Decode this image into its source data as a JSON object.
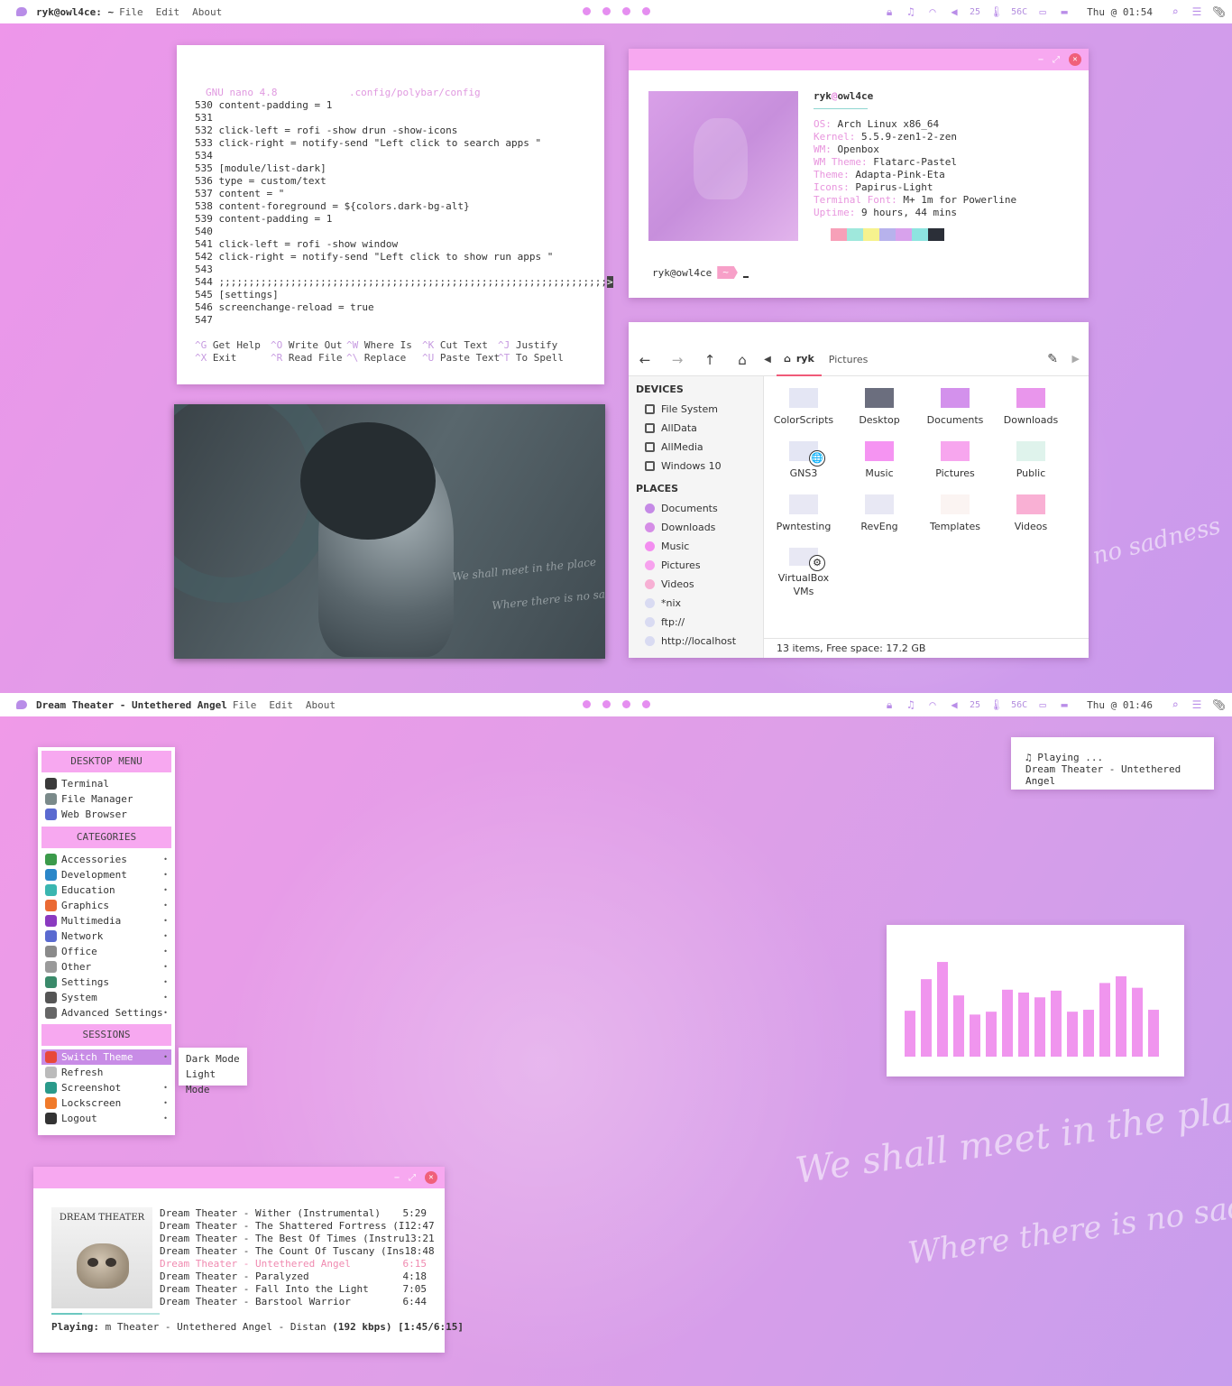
{
  "top_bar": {
    "window_title": "ryk@owl4ce: ~",
    "menu": [
      "File",
      "Edit",
      "About"
    ],
    "volume": "25",
    "temp": "56C",
    "clock": "Thu @ 01:54"
  },
  "bottom_bar": {
    "window_title": "Dream Theater - Untethered Angel",
    "menu": [
      "File",
      "Edit",
      "About"
    ],
    "volume": "25",
    "temp": "56C",
    "clock": "Thu @ 01:46"
  },
  "wallpaper_text": {
    "line1": "We shall meet in the place",
    "line2": "Where there is no sadness",
    "top_fragment": "no sadness"
  },
  "nano": {
    "header": "GNU nano 4.8            .config/polybar/config",
    "lines": [
      "530 content-padding = 1",
      "531",
      "532 click-left = rofi -show drun -show-icons",
      "533 click-right = notify-send \"Left click to search apps \"",
      "534",
      "535 [module/list-dark]",
      "536 type = custom/text",
      "537 content = \"",
      "538 content-foreground = ${colors.dark-bg-alt}",
      "539 content-padding = 1",
      "540",
      "541 click-left = rofi -show window",
      "542 click-right = notify-send \"Left click to show run apps \"",
      "543",
      "544 ;;;;;;;;;;;;;;;;;;;;;;;;;;;;;;;;;;;;;;;;;;;;;;;;;;;;;;;;;;;;;;;;;",
      "545 [settings]",
      "546 screenchange-reload = true",
      "547"
    ],
    "help": [
      {
        "key": "^G",
        "label": "Get Help"
      },
      {
        "key": "^O",
        "label": "Write Out"
      },
      {
        "key": "^W",
        "label": "Where Is"
      },
      {
        "key": "^K",
        "label": "Cut Text"
      },
      {
        "key": "^J",
        "label": "Justify"
      },
      {
        "key": "^X",
        "label": "Exit"
      },
      {
        "key": "^R",
        "label": "Read File"
      },
      {
        "key": "^\\",
        "label": "Replace"
      },
      {
        "key": "^U",
        "label": "Paste Text"
      },
      {
        "key": "^T",
        "label": "To Spell"
      }
    ]
  },
  "neofetch": {
    "user": "ryk",
    "host": "owl4ce",
    "rows": [
      {
        "k": "OS:",
        "v": "Arch Linux x86_64"
      },
      {
        "k": "Kernel:",
        "v": "5.5.9-zen1-2-zen"
      },
      {
        "k": "WM:",
        "v": "Openbox"
      },
      {
        "k": "WM Theme:",
        "v": "Flatarc-Pastel"
      },
      {
        "k": "Theme:",
        "v": "Adapta-Pink-Eta"
      },
      {
        "k": "Icons:",
        "v": "Papirus-Light"
      },
      {
        "k": "Terminal Font:",
        "v": "M+ 1m for Powerline"
      },
      {
        "k": "Uptime:",
        "v": "9 hours, 44 mins"
      }
    ],
    "swatches": [
      "#f7a0b8",
      "#9fe8dc",
      "#f6f28e",
      "#b7b2ec",
      "#d8a2ec",
      "#8ee4e0",
      "#2b2f38"
    ],
    "prompt": "ryk@owl4ce",
    "prompt_arrow": "~"
  },
  "image_text": {
    "line1": "We shall meet in the place",
    "line2": "Where there is no sadness"
  },
  "file_manager": {
    "crumb_home": "ryk",
    "crumb_current": "Pictures",
    "devices_heading": "DEVICES",
    "devices": [
      "File System",
      "AllData",
      "AllMedia",
      "Windows 10"
    ],
    "places_heading": "PLACES",
    "places": [
      {
        "label": "Documents",
        "color": "#c58ae6"
      },
      {
        "label": "Downloads",
        "color": "#d58de6"
      },
      {
        "label": "Music",
        "color": "#f38ef0"
      },
      {
        "label": "Pictures",
        "color": "#f7a2ee"
      },
      {
        "label": "Videos",
        "color": "#f7b0d4"
      },
      {
        "label": "*nix",
        "color": "#d9dbf2"
      },
      {
        "label": "ftp://",
        "color": "#d9dbf2"
      },
      {
        "label": "http://localhost",
        "color": "#d9dbf2"
      }
    ],
    "folders": [
      {
        "label": "ColorScripts",
        "color": "#e4e6f4",
        "badge": ""
      },
      {
        "label": "Desktop",
        "color": "#6b6e7e",
        "badge": ""
      },
      {
        "label": "Documents",
        "color": "#d391ec",
        "badge": ""
      },
      {
        "label": "Downloads",
        "color": "#e996ec",
        "badge": ""
      },
      {
        "label": "GNS3",
        "color": "#e4e6f4",
        "badge": "🌐"
      },
      {
        "label": "Music",
        "color": "#f594f2",
        "badge": ""
      },
      {
        "label": "Pictures",
        "color": "#f7a6ee",
        "badge": ""
      },
      {
        "label": "Public",
        "color": "#dff3ec",
        "badge": ""
      },
      {
        "label": "Pwntesting",
        "color": "#e8e8f4",
        "badge": ""
      },
      {
        "label": "RevEng",
        "color": "#e8e8f4",
        "badge": ""
      },
      {
        "label": "Templates",
        "color": "#fbf4f2",
        "badge": ""
      },
      {
        "label": "Videos",
        "color": "#f9b0d4",
        "badge": ""
      },
      {
        "label": "VirtualBox VMs",
        "color": "#e8e8f4",
        "badge": "⚙"
      }
    ],
    "status": "13 items, Free space: 17.2 GB"
  },
  "desktop_menu": {
    "header": "DESKTOP MENU",
    "apps": [
      {
        "label": "Terminal",
        "color": "#3a3a3a"
      },
      {
        "label": "File Manager",
        "color": "#7a8a8a"
      },
      {
        "label": "Web Browser",
        "color": "#5a6ad0"
      }
    ],
    "categories_header": "CATEGORIES",
    "categories": [
      {
        "label": "Accessories",
        "color": "#3b9a4a"
      },
      {
        "label": "Development",
        "color": "#2a86c8"
      },
      {
        "label": "Education",
        "color": "#3ab6b0"
      },
      {
        "label": "Graphics",
        "color": "#ea6a34"
      },
      {
        "label": "Multimedia",
        "color": "#8a3ac0"
      },
      {
        "label": "Network",
        "color": "#5a6ad0"
      },
      {
        "label": "Office",
        "color": "#8a8a8a"
      },
      {
        "label": "Other",
        "color": "#9a9a9a"
      },
      {
        "label": "Settings",
        "color": "#3a8a6a"
      },
      {
        "label": "System",
        "color": "#555555"
      },
      {
        "label": "Advanced Settings",
        "color": "#666666"
      }
    ],
    "sessions_header": "SESSIONS",
    "sessions": [
      {
        "label": "Switch Theme",
        "color": "#e8483a"
      },
      {
        "label": "Refresh",
        "color": "#bbbbbb"
      },
      {
        "label": "Screenshot",
        "color": "#2a9a8a"
      },
      {
        "label": "Lockscreen",
        "color": "#f07a2a"
      },
      {
        "label": "Logout",
        "color": "#333333"
      }
    ],
    "submenu": [
      "Dark Mode",
      "Light Mode"
    ]
  },
  "notification": {
    "line1": "♫ Playing ...",
    "line2": "Dream Theater - Untethered Angel"
  },
  "visualizer": {
    "bar_color": "#f095ee",
    "levels": [
      0.48,
      0.81,
      0.99,
      0.64,
      0.44,
      0.47,
      0.7,
      0.67,
      0.62,
      0.69,
      0.47,
      0.49,
      0.77,
      0.84,
      0.72,
      0.49
    ]
  },
  "player": {
    "album_text": "DREAM THEATER",
    "tracks": [
      {
        "title": "Dream Theater - Wither (Instrumental)",
        "time": "5:29",
        "current": false
      },
      {
        "title": "Dream Theater - The Shattered Fortress (I",
        "time": "12:47",
        "current": false
      },
      {
        "title": "Dream Theater - The Best Of Times (Instru",
        "time": "13:21",
        "current": false
      },
      {
        "title": "Dream Theater - The Count Of Tuscany (Ins",
        "time": "18:48",
        "current": false
      },
      {
        "title": "Dream Theater - Untethered Angel",
        "time": "6:15",
        "current": true
      },
      {
        "title": "Dream Theater - Paralyzed",
        "time": "4:18",
        "current": false
      },
      {
        "title": "Dream Theater - Fall Into the Light",
        "time": "7:05",
        "current": false
      },
      {
        "title": "Dream Theater - Barstool Warrior",
        "time": "6:44",
        "current": false
      }
    ],
    "now_playing_label": "Playing:",
    "now_playing_title": " m Theater - Untethered Angel - Distan ",
    "now_playing_bitrate": "(192 kbps)",
    "now_playing_pos": " [1:45/6:15]",
    "progress": 0.28
  }
}
